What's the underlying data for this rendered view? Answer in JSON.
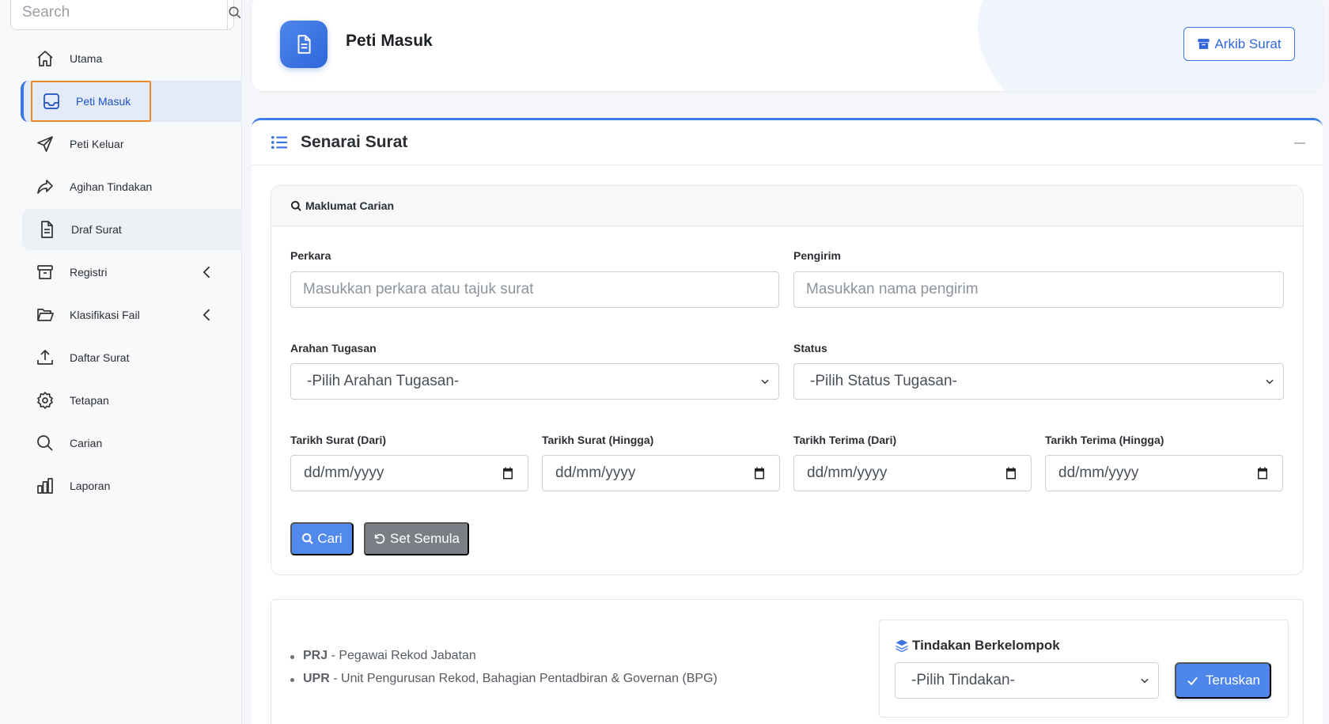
{
  "sidebar": {
    "search": {
      "placeholder": "Search"
    },
    "items": [
      {
        "label": "Utama",
        "icon": "home-icon"
      },
      {
        "label": "Peti Masuk",
        "icon": "inbox-icon"
      },
      {
        "label": "Peti Keluar",
        "icon": "send-icon"
      },
      {
        "label": "Agihan Tindakan",
        "icon": "share-icon"
      },
      {
        "label": "Draf Surat",
        "icon": "document-icon"
      },
      {
        "label": "Registri",
        "icon": "archive-icon"
      },
      {
        "label": "Klasifikasi Fail",
        "icon": "folder-open-icon"
      },
      {
        "label": "Daftar Surat",
        "icon": "upload-icon"
      },
      {
        "label": "Tetapan",
        "icon": "gear-icon"
      },
      {
        "label": "Carian",
        "icon": "search-icon"
      },
      {
        "label": "Laporan",
        "icon": "bar-chart-icon"
      }
    ]
  },
  "header": {
    "title": "Peti Masuk",
    "archive_button": "Arkib Surat"
  },
  "main": {
    "title": "Senarai Surat",
    "search_panel": {
      "title": "Maklumat Carian",
      "perkara": {
        "label": "Perkara",
        "placeholder": "Masukkan perkara atau tajuk surat"
      },
      "pengirim": {
        "label": "Pengirim",
        "placeholder": "Masukkan nama pengirim"
      },
      "arahan": {
        "label": "Arahan Tugasan",
        "value": "-Pilih Arahan Tugasan-"
      },
      "status": {
        "label": "Status",
        "value": "-Pilih Status Tugasan-"
      },
      "dates": [
        {
          "label": "Tarikh Surat (Dari)",
          "value": "dd/mm/yyyy"
        },
        {
          "label": "Tarikh Surat (Hingga)",
          "value": "dd/mm/yyyy"
        },
        {
          "label": "Tarikh Terima (Dari)",
          "value": "dd/mm/yyyy"
        },
        {
          "label": "Tarikh Terima (Hingga)",
          "value": "dd/mm/yyyy"
        }
      ],
      "search_button": "Cari",
      "reset_button": "Set Semula"
    },
    "legend": [
      {
        "code": "PRJ",
        "desc": "- Pegawai Rekod Jabatan"
      },
      {
        "code": "UPR",
        "desc": "- Unit Pengurusan Rekod, Bahagian Pentadbiran & Governan (BPG)"
      }
    ],
    "group_action": {
      "title": "Tindakan Berkelompok",
      "select_value": "-Pilih Tindakan-",
      "button": "Teruskan"
    }
  },
  "colors": {
    "accent": "#3b76e1",
    "highlight": "#f0882a",
    "reset_button": "#7a7f85"
  }
}
